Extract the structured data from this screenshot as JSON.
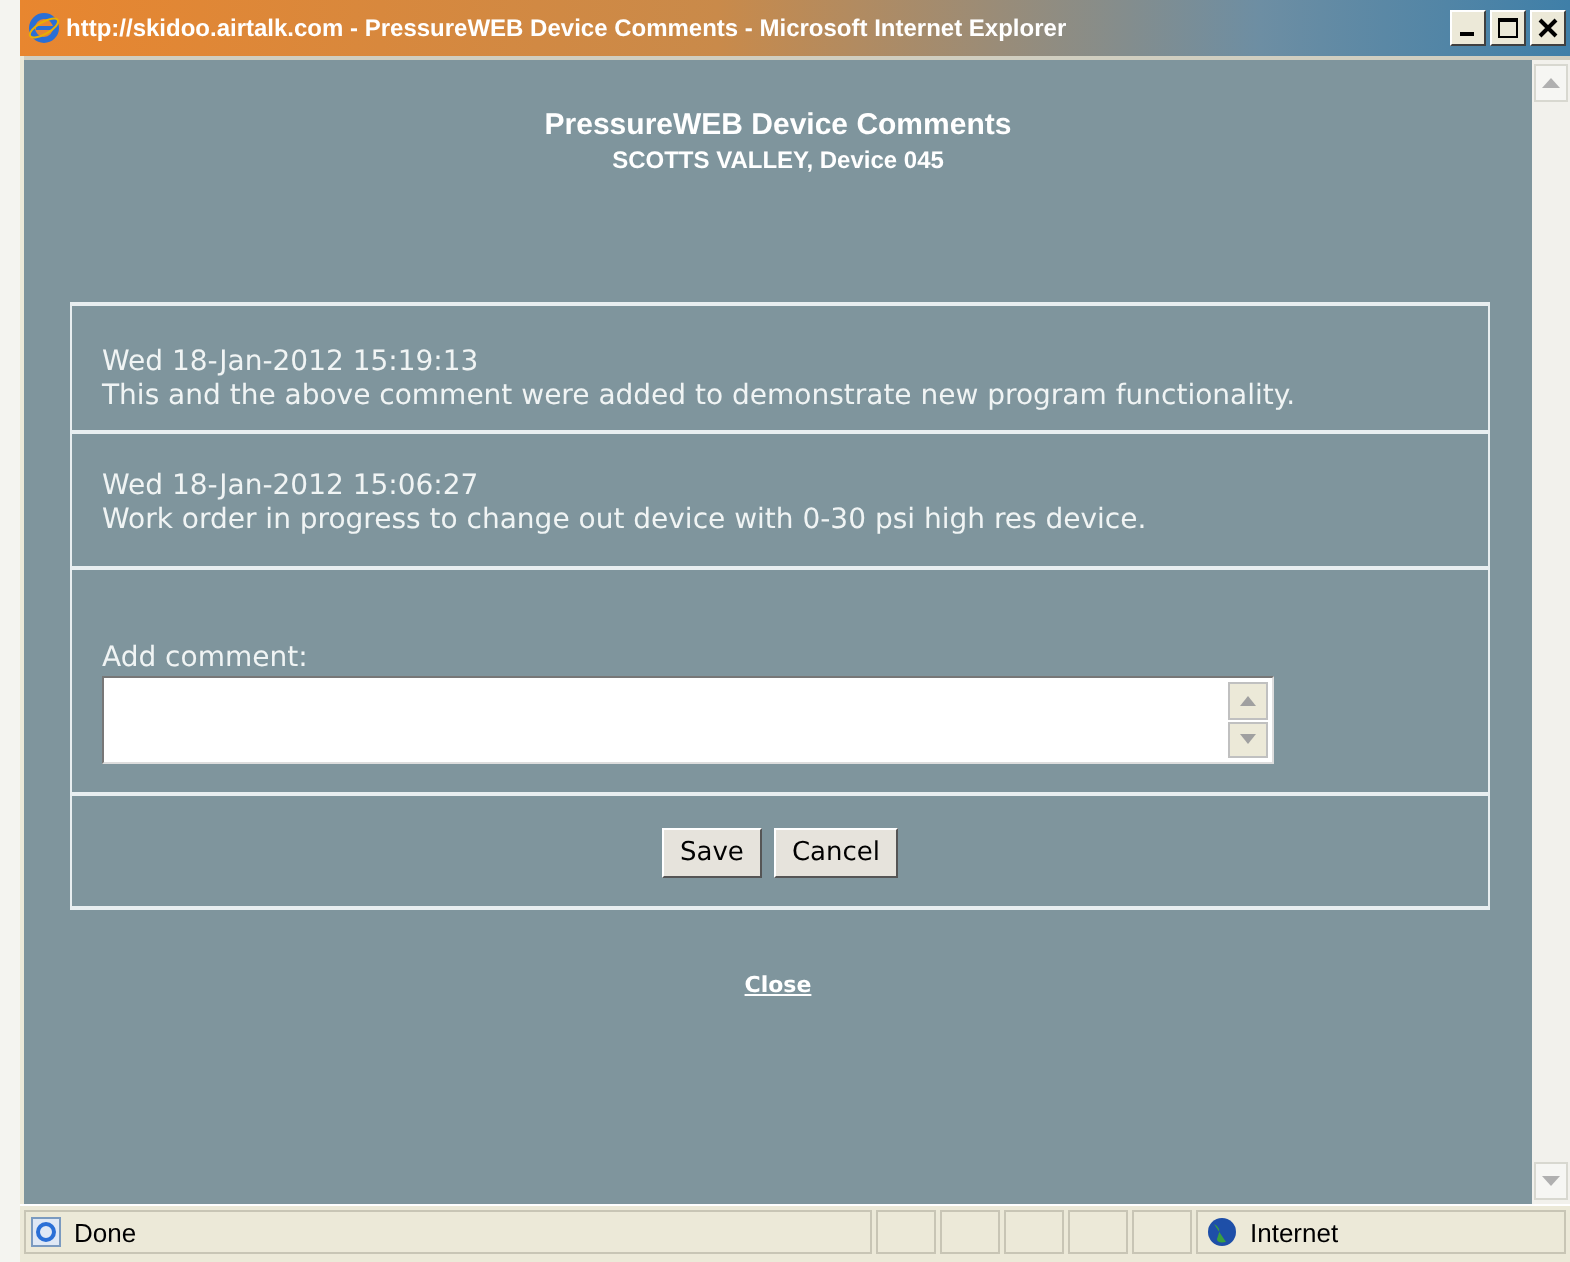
{
  "window": {
    "title": "http://skidoo.airtalk.com - PressureWEB Device Comments - Microsoft Internet Explorer"
  },
  "page": {
    "heading": "PressureWEB Device Comments",
    "subheading": "SCOTTS VALLEY, Device 045"
  },
  "comments": [
    {
      "timestamp": "Wed 18-Jan-2012 15:19:13",
      "text": "This and the above comment were added to demonstrate new program functionality."
    },
    {
      "timestamp": "Wed 18-Jan-2012 15:06:27",
      "text": "Work order in progress to change out device with 0-30 psi high res device."
    }
  ],
  "add_comment": {
    "label": "Add comment:"
  },
  "buttons": [
    "Save",
    "Cancel"
  ],
  "close_link": "Close",
  "status_bar": {
    "status": "Done",
    "zone": "Internet"
  }
}
